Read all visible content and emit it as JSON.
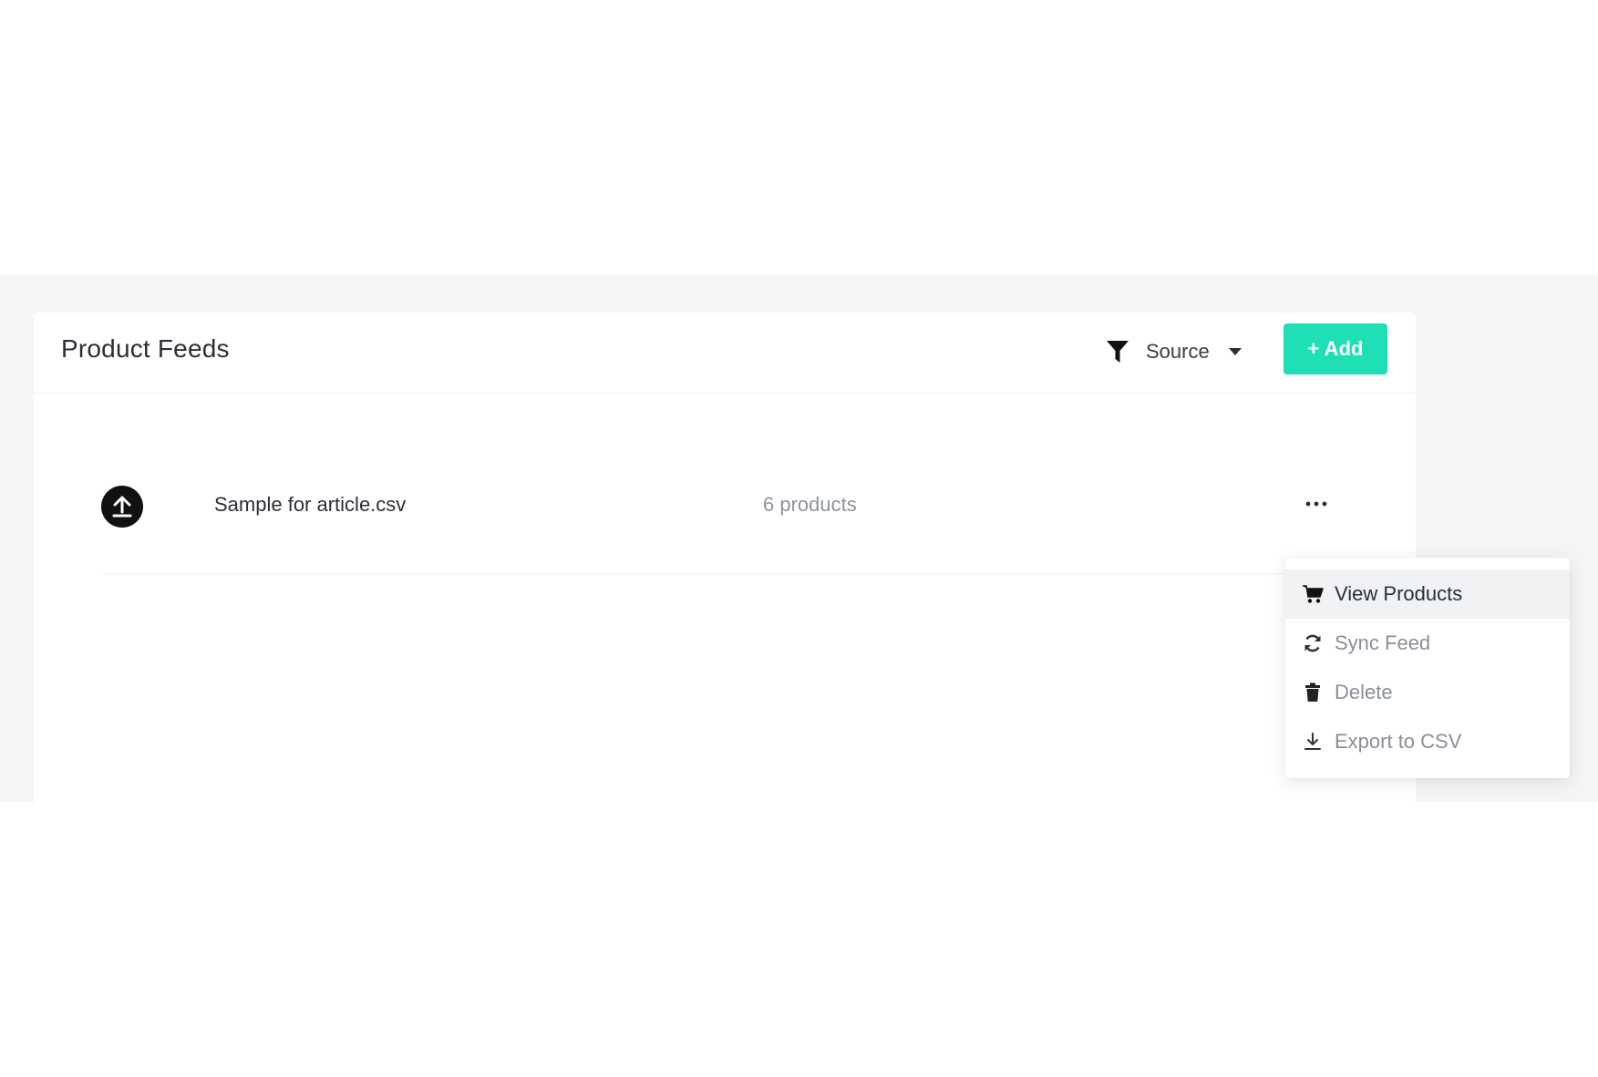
{
  "header": {
    "title": "Product Feeds",
    "filter_label": "Source",
    "add_label": "+ Add"
  },
  "feeds": [
    {
      "name": "Sample for article.csv",
      "count": "6 products",
      "icon": "upload-icon"
    }
  ],
  "menu": {
    "items": [
      {
        "label": "View Products",
        "icon": "cart-icon",
        "active": true
      },
      {
        "label": "Sync Feed",
        "icon": "sync-icon",
        "active": false
      },
      {
        "label": "Delete",
        "icon": "trash-icon",
        "active": false
      },
      {
        "label": "Export to CSV",
        "icon": "download-icon",
        "active": false
      }
    ]
  },
  "colors": {
    "accent": "#1fdfb4",
    "background": "#f4f5f6",
    "text_primary": "#2b2f36",
    "text_muted": "#8e939b"
  }
}
